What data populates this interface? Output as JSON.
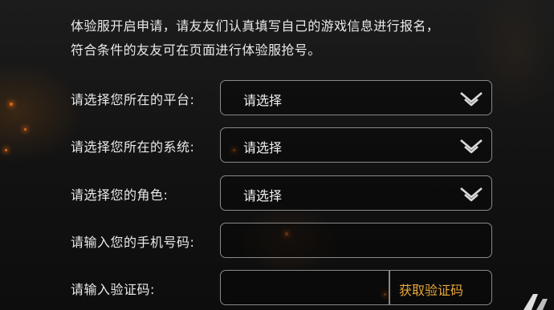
{
  "intro": {
    "line1": "体验服开启申请，请友友们认真填写自己的游戏信息进行报名，",
    "line2": "符合条件的友友可在页面进行体验服抢号。"
  },
  "form": {
    "platform": {
      "label": "请选择您所在的平台:",
      "value": "请选择"
    },
    "system": {
      "label": "请选择您所在的系统:",
      "value": "请选择"
    },
    "role": {
      "label": "请选择您的角色:",
      "value": "请选择"
    },
    "phone": {
      "label": "请输入您的手机号码:",
      "value": ""
    },
    "code": {
      "label": "请输入验证码:",
      "value": "",
      "button_label": "获取验证码"
    }
  },
  "colors": {
    "accent": "#e8a63a",
    "border": "#8a8a8a",
    "text": "#e9e9e9"
  },
  "icons": {
    "dropdown": "chevron-down-icon",
    "logo": "watermark-logo"
  }
}
